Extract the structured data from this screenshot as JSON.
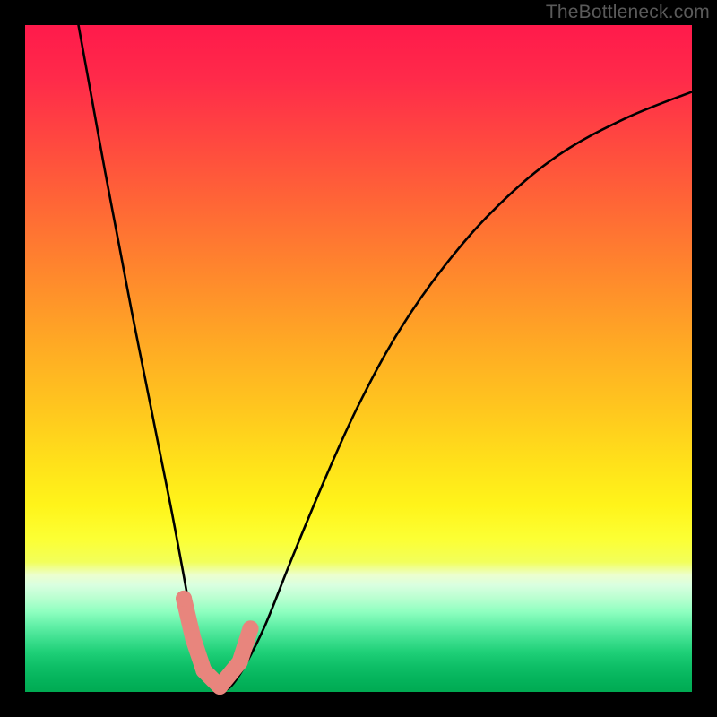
{
  "watermark": {
    "text": "TheBottleneck.com"
  },
  "chart_data": {
    "type": "line",
    "title": "",
    "xlabel": "",
    "ylabel": "",
    "xlim": [
      0,
      100
    ],
    "ylim": [
      0,
      100
    ],
    "grid": false,
    "legend": false,
    "background": "rainbow-gradient (red top → green bottom)",
    "series": [
      {
        "name": "bottleneck-curve",
        "color": "#000000",
        "x": [
          8,
          10,
          12,
          14,
          16,
          18,
          20,
          22,
          23.5,
          25,
          26.5,
          28,
          29.5,
          31,
          33,
          36,
          40,
          45,
          50,
          56,
          63,
          71,
          80,
          90,
          100
        ],
        "y": [
          100,
          89,
          78,
          67.5,
          57,
          47,
          37,
          27,
          19,
          11,
          5,
          1.5,
          0.3,
          1,
          4,
          10,
          20,
          32,
          43,
          54,
          64,
          73,
          80.5,
          86,
          90
        ]
      }
    ],
    "markers": [
      {
        "name": "highlight-points",
        "color": "#e8857d",
        "shape": "rounded-octagon",
        "size": 18,
        "points": [
          {
            "x": 23.8,
            "y": 14
          },
          {
            "x": 25.2,
            "y": 8
          },
          {
            "x": 26.8,
            "y": 3.2
          },
          {
            "x": 29.2,
            "y": 0.8
          },
          {
            "x": 32.2,
            "y": 4.5
          },
          {
            "x": 33.8,
            "y": 9.5
          }
        ]
      }
    ]
  }
}
